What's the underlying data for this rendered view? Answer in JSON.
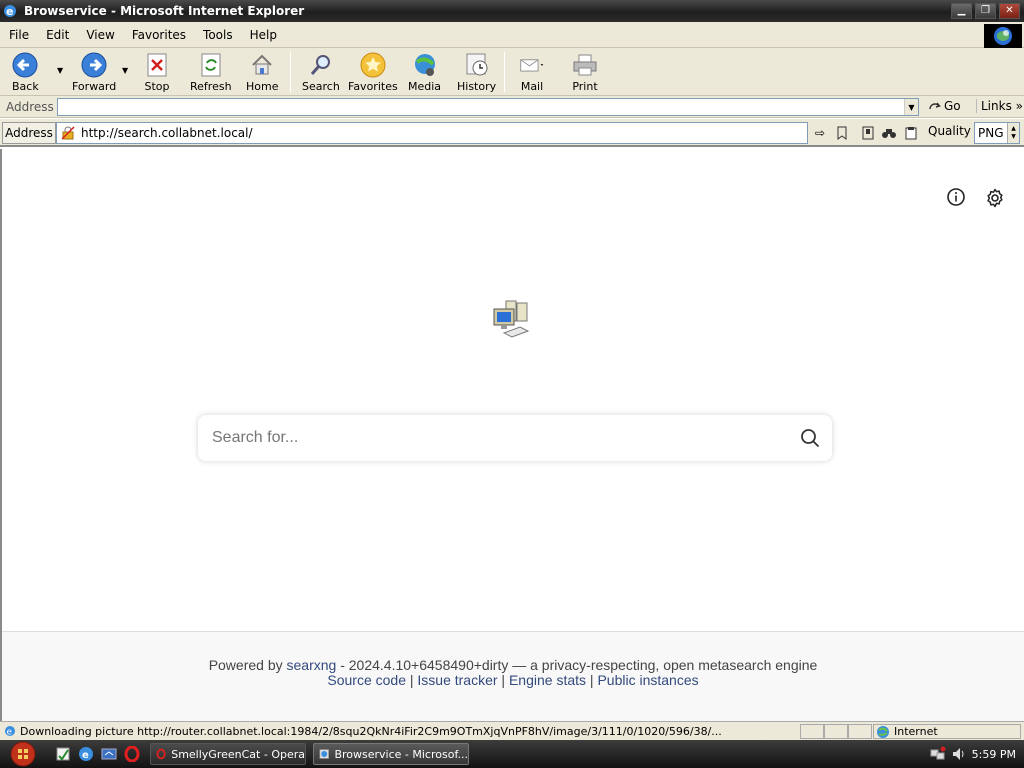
{
  "window": {
    "title": "Browservice - Microsoft Internet Explorer",
    "controls": [
      "minimize",
      "maximize",
      "close"
    ]
  },
  "menu": [
    "File",
    "Edit",
    "View",
    "Favorites",
    "Tools",
    "Help"
  ],
  "toolbar": {
    "back": "Back",
    "forward": "Forward",
    "stop": "Stop",
    "refresh": "Refresh",
    "home": "Home",
    "search": "Search",
    "favorites": "Favorites",
    "media": "Media",
    "history": "History",
    "mail": "Mail",
    "print": "Print"
  },
  "address_bar": {
    "label": "Address",
    "value": "",
    "go": "Go",
    "links": "Links"
  },
  "browservice_bar": {
    "label": "Address",
    "url": "http://search.collabnet.local/",
    "quality_label": "Quality",
    "quality_value": "PNG"
  },
  "page": {
    "search_placeholder": "Search for...",
    "footer": {
      "powered_by": "Powered by",
      "engine_link": "searxng",
      "version_text": " - 2024.4.10+6458490+dirty — a privacy-respecting, open metasearch engine",
      "links": [
        "Source code",
        "Issue tracker",
        "Engine stats",
        "Public instances"
      ],
      "separator": " | "
    }
  },
  "status": {
    "text": "Downloading picture http://router.collabnet.local:1984/2/8squ2QkNr4iFir2C9m9OTmXjqVnPF8hV/image/3/111/0/1020/596/38/...",
    "zone": "Internet"
  },
  "taskbar": {
    "tasks": [
      {
        "label": "SmellyGreenCat - Opera",
        "active": false
      },
      {
        "label": "Browservice - Microsof...",
        "active": true
      }
    ],
    "clock": "5:59 PM"
  }
}
